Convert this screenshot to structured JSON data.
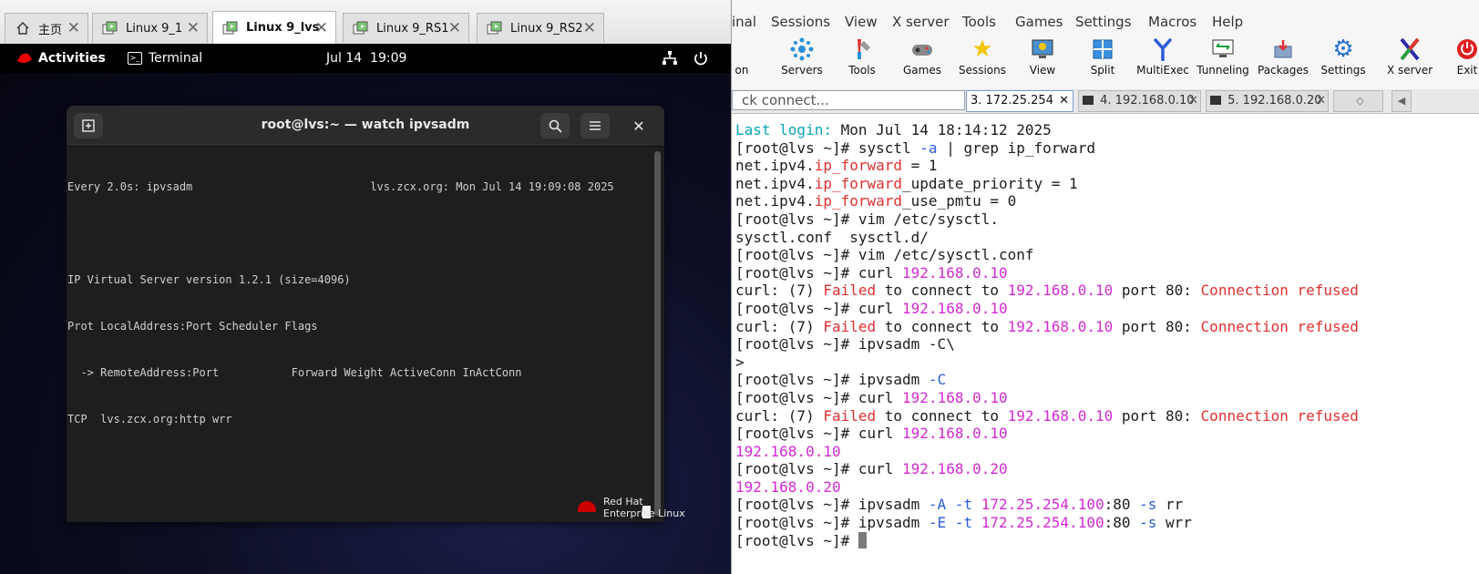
{
  "vm_tabs": [
    {
      "label": "主页",
      "icon": "home-icon"
    },
    {
      "label": "Linux 9_1",
      "icon": "vm-icon"
    },
    {
      "label": "Linux 9_lvs",
      "icon": "vm-icon",
      "active": true
    },
    {
      "label": "Linux 9_RS1",
      "icon": "vm-icon"
    },
    {
      "label": "Linux 9_RS2",
      "icon": "vm-icon"
    }
  ],
  "gnome": {
    "activities": "Activities",
    "terminal": "Terminal",
    "clock": "Jul 14  19:09"
  },
  "gterm": {
    "title": "root@lvs:~ — watch ipvsadm",
    "lines": [
      "Every 2.0s: ipvsadm                           lvs.zcx.org: Mon Jul 14 19:09:08 2025",
      "",
      "IP Virtual Server version 1.2.1 (size=4096)",
      "Prot LocalAddress:Port Scheduler Flags",
      "  -> RemoteAddress:Port           Forward Weight ActiveConn InActConn",
      "TCP  lvs.zcx.org:http wrr"
    ]
  },
  "rh_logo": {
    "line1": "Red Hat",
    "line2": "Enterprise Linux"
  },
  "moba": {
    "menu": [
      "inal",
      "Sessions",
      "View",
      "X server",
      "Tools",
      "Games",
      "Settings",
      "Macros",
      "Help"
    ],
    "toolbar": [
      {
        "label": "on",
        "icon": ""
      },
      {
        "label": "Servers",
        "icon": "servers-icon"
      },
      {
        "label": "Tools",
        "icon": "tools-icon"
      },
      {
        "label": "Games",
        "icon": "games-icon"
      },
      {
        "label": "Sessions",
        "icon": "star-icon"
      },
      {
        "label": "View",
        "icon": "view-icon"
      },
      {
        "label": "Split",
        "icon": "split-icon"
      },
      {
        "label": "MultiExec",
        "icon": "multiexec-icon"
      },
      {
        "label": "Tunneling",
        "icon": "tunneling-icon"
      },
      {
        "label": "Packages",
        "icon": "packages-icon"
      },
      {
        "label": "Settings",
        "icon": "gear-icon"
      },
      {
        "label": "X server",
        "icon": "x-server-icon"
      },
      {
        "label": "Exit",
        "icon": "power-icon"
      }
    ],
    "quick_connect": "ck connect...",
    "tabs": [
      {
        "label": "3. 172.25.254",
        "active": true
      },
      {
        "label": "4. 192.168.0.10",
        "active": false
      },
      {
        "label": "5. 192.168.0.20",
        "active": false
      }
    ],
    "terminal_lines": [
      [
        {
          "t": "Last login:",
          "c": "cyan"
        },
        {
          "t": " Mon Jul 14 18:14:12 2025"
        }
      ],
      [
        {
          "t": "[root@lvs ~]# sysctl "
        },
        {
          "t": "-a",
          "c": "blue"
        },
        {
          "t": " | grep ip_forward"
        }
      ],
      [
        {
          "t": "net.ipv4."
        },
        {
          "t": "ip_forward",
          "c": "red"
        },
        {
          "t": " = 1"
        }
      ],
      [
        {
          "t": "net.ipv4."
        },
        {
          "t": "ip_forward",
          "c": "red"
        },
        {
          "t": "_update_priority = 1"
        }
      ],
      [
        {
          "t": "net.ipv4."
        },
        {
          "t": "ip_forward",
          "c": "red"
        },
        {
          "t": "_use_pmtu = 0"
        }
      ],
      [
        {
          "t": "[root@lvs ~]# vim /etc/sysctl."
        }
      ],
      [
        {
          "t": "sysctl.conf  sysctl.d/"
        }
      ],
      [
        {
          "t": "[root@lvs ~]# vim /etc/sysctl.conf"
        }
      ],
      [
        {
          "t": "[root@lvs ~]# curl "
        },
        {
          "t": "192.168.0.10",
          "c": "mag"
        }
      ],
      [
        {
          "t": "curl: (7) "
        },
        {
          "t": "Failed",
          "c": "red"
        },
        {
          "t": " to connect to "
        },
        {
          "t": "192.168.0.10",
          "c": "mag"
        },
        {
          "t": " port 80: "
        },
        {
          "t": "Connection refused",
          "c": "red"
        }
      ],
      [
        {
          "t": "[root@lvs ~]# curl "
        },
        {
          "t": "192.168.0.10",
          "c": "mag"
        }
      ],
      [
        {
          "t": "curl: (7) "
        },
        {
          "t": "Failed",
          "c": "red"
        },
        {
          "t": " to connect to "
        },
        {
          "t": "192.168.0.10",
          "c": "mag"
        },
        {
          "t": " port 80: "
        },
        {
          "t": "Connection refused",
          "c": "red"
        }
      ],
      [
        {
          "t": "[root@lvs ~]# ipvsadm -C\\"
        }
      ],
      [
        {
          "t": ">"
        }
      ],
      [
        {
          "t": "[root@lvs ~]# ipvsadm "
        },
        {
          "t": "-C",
          "c": "blue"
        }
      ],
      [
        {
          "t": "[root@lvs ~]# curl "
        },
        {
          "t": "192.168.0.10",
          "c": "mag"
        }
      ],
      [
        {
          "t": "curl: (7) "
        },
        {
          "t": "Failed",
          "c": "red"
        },
        {
          "t": " to connect to "
        },
        {
          "t": "192.168.0.10",
          "c": "mag"
        },
        {
          "t": " port 80: "
        },
        {
          "t": "Connection refused",
          "c": "red"
        }
      ],
      [
        {
          "t": "[root@lvs ~]# curl "
        },
        {
          "t": "192.168.0.10",
          "c": "mag"
        }
      ],
      [
        {
          "t": "192.168.0.10",
          "c": "mag"
        }
      ],
      [
        {
          "t": "[root@lvs ~]# curl "
        },
        {
          "t": "192.168.0.20",
          "c": "mag"
        }
      ],
      [
        {
          "t": "192.168.0.20",
          "c": "mag"
        }
      ],
      [
        {
          "t": "[root@lvs ~]# ipvsadm "
        },
        {
          "t": "-A",
          "c": "blue"
        },
        {
          "t": " "
        },
        {
          "t": "-t",
          "c": "blue"
        },
        {
          "t": " "
        },
        {
          "t": "172.25.254.100",
          "c": "mag"
        },
        {
          "t": ":80 "
        },
        {
          "t": "-s",
          "c": "blue"
        },
        {
          "t": " rr"
        }
      ],
      [
        {
          "t": "[root@lvs ~]# ipvsadm "
        },
        {
          "t": "-E",
          "c": "blue"
        },
        {
          "t": " "
        },
        {
          "t": "-t",
          "c": "blue"
        },
        {
          "t": " "
        },
        {
          "t": "172.25.254.100",
          "c": "mag"
        },
        {
          "t": ":80 "
        },
        {
          "t": "-s",
          "c": "blue"
        },
        {
          "t": " wrr"
        }
      ],
      [
        {
          "t": "[root@lvs ~]# "
        }
      ]
    ]
  },
  "colors": {
    "cyan": "#0aa5b8",
    "magenta": "#d12ad1",
    "red": "#e03030",
    "blue": "#2a5cd8"
  }
}
